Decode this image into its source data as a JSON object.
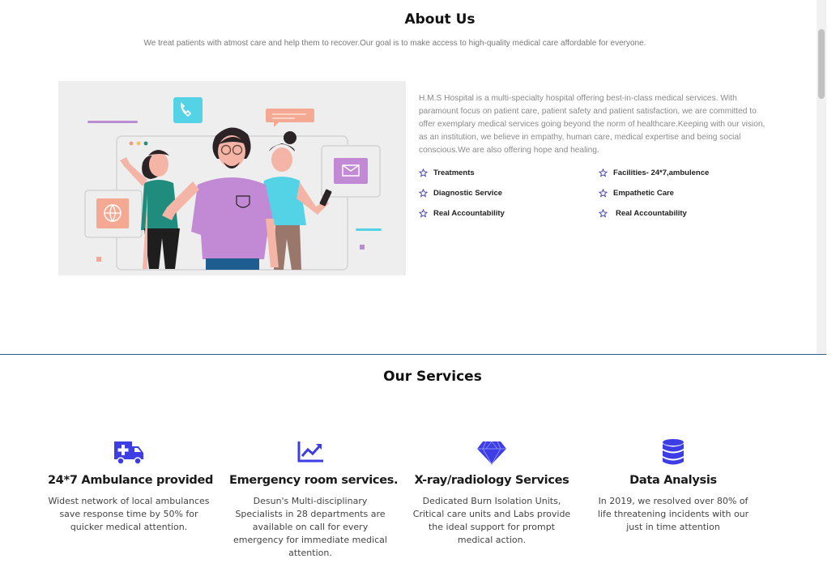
{
  "about": {
    "title": "About Us",
    "tagline": "We treat patients with atmost care and help them to recover.Our goal is to make access to high-quality medical care affordable for everyone.",
    "description": "H.M.S Hospital is a multi-specialty hospital offering best-in-class medical services. With paramount focus on patient care, patient safety and patient satisfaction, we are committed to offer exemplary medical services going beyond the norm of healthcare.Keeping with our vision, as an institution, we believe in empathy, human care, medical expertise and being social conscious.We are also offering hope and healing.",
    "features": [
      {
        "label": "Treatments"
      },
      {
        "label": "Facilities- 24*7,ambulence"
      },
      {
        "label": "Diagnostic Service"
      },
      {
        "label": "Empathetic Care"
      },
      {
        "label": "Real Accountability"
      },
      {
        "label": "Real Accountability"
      }
    ],
    "star_color": "#3b3bb3"
  },
  "services": {
    "title": "Our Services",
    "icon_color": "#3d3de6",
    "items": [
      {
        "icon": "ambulance-icon",
        "title": "24*7 Ambulance provided",
        "text": "Widest network of local ambulances save response time by 50% for quicker medical attention."
      },
      {
        "icon": "chart-line-icon",
        "title": "Emergency room services.",
        "text": "Desun's Multi-disciplinary Specialists in 28 departments are available on call for every emergency for immediate medical attention."
      },
      {
        "icon": "gem-icon",
        "title": "X-ray/radiology Services",
        "text": "Dedicated Burn Isolation Units, Critical care units and Labs provide the ideal support for prompt medical action."
      },
      {
        "icon": "database-icon",
        "title": "Data Analysis",
        "text": "In 2019, we resolved over 80% of life threatening incidents with our just in time attention"
      }
    ]
  }
}
